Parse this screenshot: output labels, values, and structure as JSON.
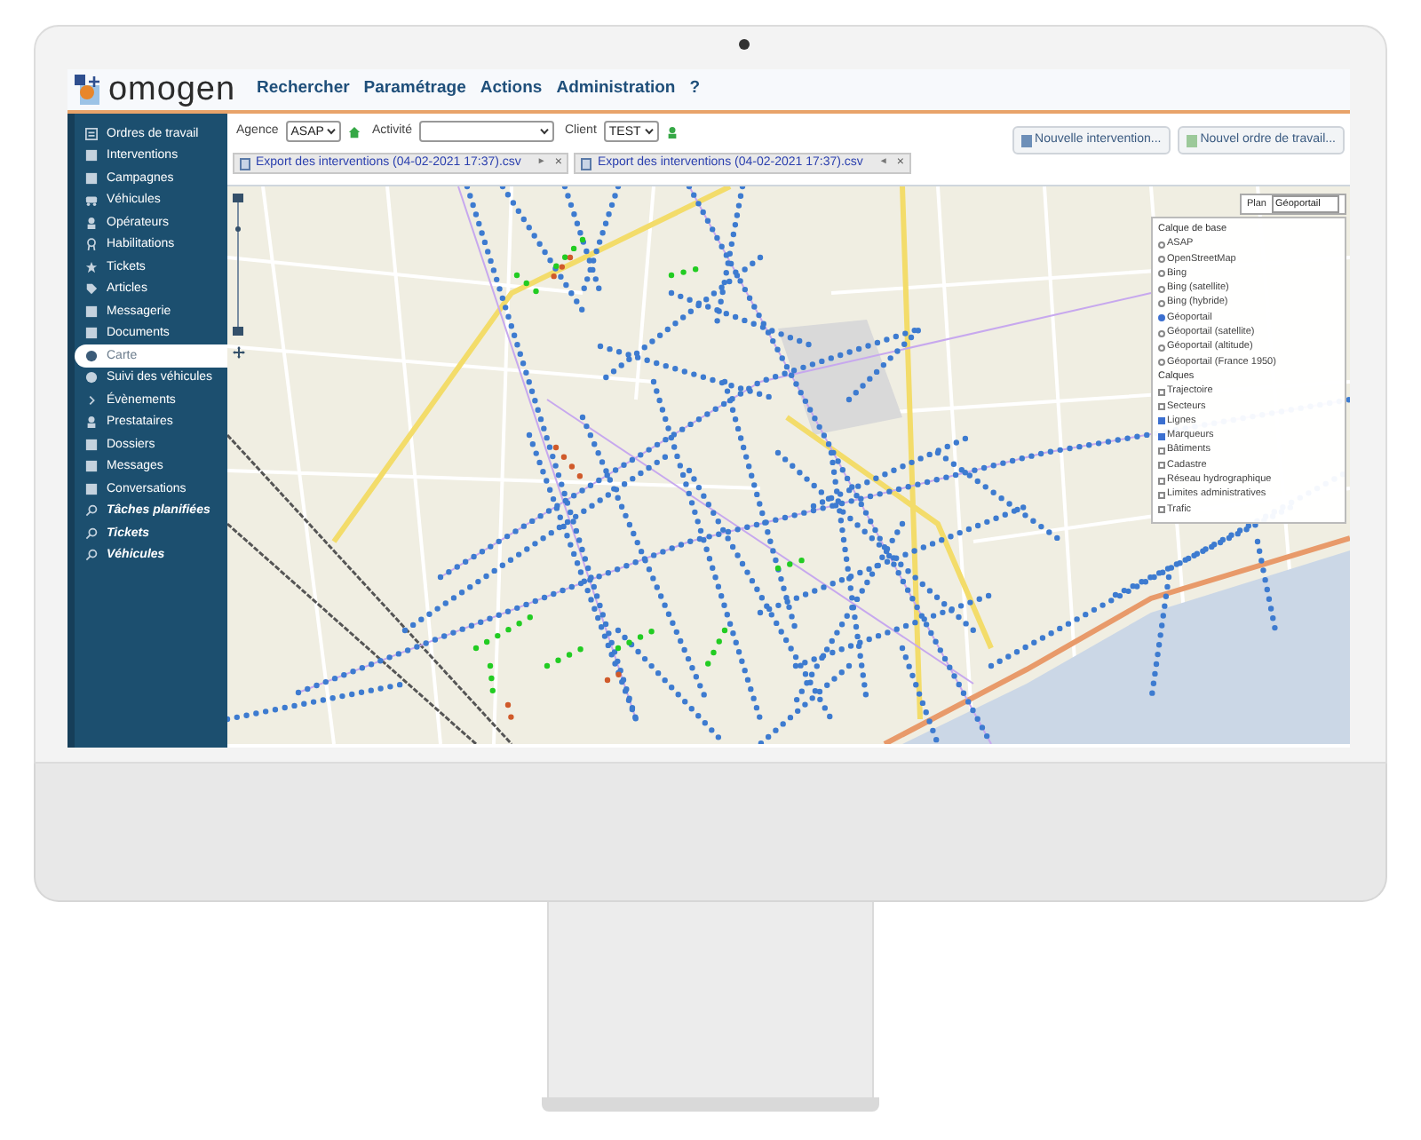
{
  "app": {
    "logo": "omogen",
    "menu": [
      "Rechercher",
      "Paramétrage",
      "Actions",
      "Administration",
      "?"
    ]
  },
  "sidebar": {
    "items": [
      {
        "label": "Ordres de travail",
        "kind": "page",
        "selected": false
      },
      {
        "label": "Interventions",
        "kind": "page",
        "selected": false
      },
      {
        "label": "Campagnes",
        "kind": "page",
        "selected": false
      },
      {
        "label": "Véhicules",
        "kind": "page",
        "selected": false
      },
      {
        "label": "Opérateurs",
        "kind": "page",
        "selected": false
      },
      {
        "label": "Habilitations",
        "kind": "page",
        "selected": false
      },
      {
        "label": "Tickets",
        "kind": "page",
        "selected": false
      },
      {
        "label": "Articles",
        "kind": "page",
        "selected": false
      },
      {
        "label": "Messagerie",
        "kind": "page",
        "selected": false
      },
      {
        "label": "Documents",
        "kind": "page",
        "selected": false
      },
      {
        "label": "Carte",
        "kind": "page",
        "selected": true
      },
      {
        "label": "Suivi des véhicules",
        "kind": "page",
        "selected": false
      },
      {
        "label": "Évènements",
        "kind": "page",
        "selected": false
      },
      {
        "label": "Prestataires",
        "kind": "page",
        "selected": false
      },
      {
        "label": "Dossiers",
        "kind": "page",
        "selected": false
      },
      {
        "label": "Messages",
        "kind": "page",
        "selected": false
      },
      {
        "label": "Conversations",
        "kind": "page",
        "selected": false
      },
      {
        "label": "Tâches planifiées",
        "kind": "search",
        "selected": false
      },
      {
        "label": "Tickets",
        "kind": "search",
        "selected": false
      },
      {
        "label": "Véhicules",
        "kind": "search",
        "selected": false
      }
    ]
  },
  "toolbar": {
    "filters": [
      {
        "label": "Agence",
        "value": "ASAP"
      },
      {
        "label": "Activité"
      },
      {
        "label": "Client",
        "value": "TEST"
      }
    ],
    "buttons": [
      "Nouvelle intervention...",
      "Nouvel ordre de travail..."
    ],
    "file_tabs": [
      {
        "label": "Export des interventions (04-02-2021 17:37).csv",
        "arrow": "►",
        "close": "×"
      },
      {
        "label": "Export des interventions (04-02-2021 17:37).csv",
        "arrow": "◄",
        "close": "×"
      }
    ]
  },
  "map": {
    "layer_switcher": {
      "plan_label": "Plan",
      "plan_value": "Géoportail",
      "base_title": "Calque de base",
      "base_layers": [
        {
          "label": "ASAP",
          "selected": false
        },
        {
          "label": "OpenStreetMap",
          "selected": false
        },
        {
          "label": "Bing",
          "selected": false
        },
        {
          "label": "Bing (satellite)",
          "selected": false
        },
        {
          "label": "Bing (hybride)",
          "selected": false
        },
        {
          "label": "Géoportail",
          "selected": true
        },
        {
          "label": "Géoportail (satellite)",
          "selected": false
        },
        {
          "label": "Géoportail (altitude)",
          "selected": false
        },
        {
          "label": "Géoportail (France 1950)",
          "selected": false
        }
      ],
      "overlay_title": "Calques",
      "overlays": [
        {
          "label": "Trajectoire",
          "checked": false
        },
        {
          "label": "Secteurs",
          "checked": false
        },
        {
          "label": "Lignes",
          "checked": true
        },
        {
          "label": "Marqueurs",
          "checked": true
        },
        {
          "label": "Bâtiments",
          "checked": false
        },
        {
          "label": "Cadastre",
          "checked": false
        },
        {
          "label": "Réseau hydrographique",
          "checked": false
        },
        {
          "label": "Limites administratives",
          "checked": false
        },
        {
          "label": "Trafic",
          "checked": false
        }
      ]
    }
  }
}
